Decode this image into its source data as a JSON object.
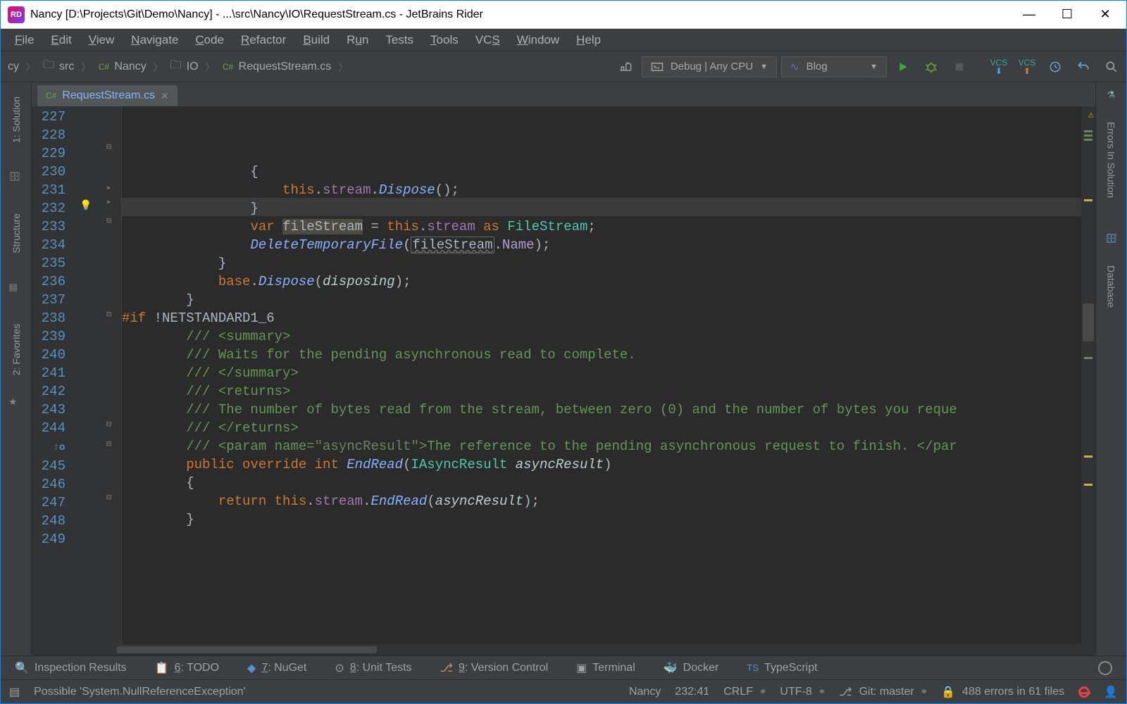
{
  "window": {
    "title": "Nancy [D:\\Projects\\Git\\Demo\\Nancy] - ...\\src\\Nancy\\IO\\RequestStream.cs - JetBrains Rider"
  },
  "menu": [
    "File",
    "Edit",
    "View",
    "Navigate",
    "Code",
    "Refactor",
    "Build",
    "Run",
    "Tests",
    "Tools",
    "VCS",
    "Window",
    "Help"
  ],
  "breadcrumb": {
    "items": [
      {
        "label": "cy"
      },
      {
        "label": "src",
        "icon": "folder"
      },
      {
        "label": "Nancy",
        "icon": "cs"
      },
      {
        "label": "IO",
        "icon": "folder"
      },
      {
        "label": "RequestStream.cs",
        "icon": "cs"
      }
    ]
  },
  "toolbar": {
    "config_label": "Debug | Any CPU",
    "run_config_label": "Blog"
  },
  "left_tabs": [
    "1: Solution",
    "Structure",
    "2: Favorites"
  ],
  "right_tabs": [
    "Errors In Solution",
    "Database"
  ],
  "tabs": [
    {
      "label": "RequestStream.cs"
    }
  ],
  "editor": {
    "first_line": 227,
    "lines": [
      "                {",
      "                    this.stream.Dispose();",
      "                }",
      "",
      "                var fileStream = this.stream as FileStream;",
      "                DeleteTemporaryFile(fileStream.Name);",
      "            }",
      "",
      "            base.Dispose(disposing);",
      "        }",
      "#if !NETSTANDARD1_6",
      "        /// <summary>",
      "        /// Waits for the pending asynchronous read to complete.",
      "        /// </summary>",
      "        /// <returns>",
      "        /// The number of bytes read from the stream, between zero (0) and the number of bytes you reque",
      "        /// </returns>",
      "        /// <param name=\"asyncResult\">The reference to the pending asynchronous request to finish. </par",
      "        public override int EndRead(IAsyncResult asyncResult)",
      "        {",
      "            return this.stream.EndRead(asyncResult);",
      "        }",
      ""
    ]
  },
  "bottom_tools": [
    "Inspection Results",
    "6: TODO",
    "7: NuGet",
    "8: Unit Tests",
    "9: Version Control",
    "Terminal",
    "Docker",
    "TypeScript"
  ],
  "status": {
    "hint": "Possible 'System.NullReferenceException'",
    "project": "Nancy",
    "cursor": "232:41",
    "line_sep": "CRLF",
    "encoding": "UTF-8",
    "git": "Git: master",
    "errors": "488 errors in 61 files"
  }
}
